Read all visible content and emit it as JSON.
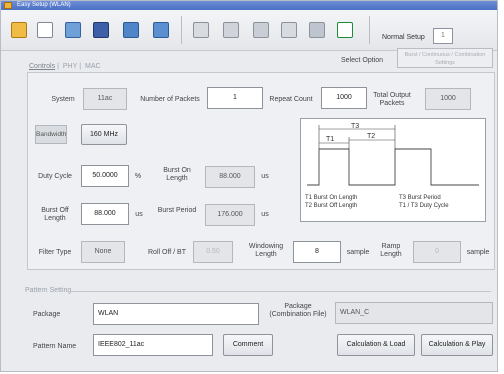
{
  "window": {
    "title": "Easy Setup (WLAN)"
  },
  "toolbar": {
    "normal_setup_label": "Normal Setup",
    "normal_setup_value": "1"
  },
  "select_option": {
    "label": "Select Option",
    "button_text": "Burst / Continuous / Combination Settings"
  },
  "tabs": [
    "Controls",
    "PHY",
    "MAC"
  ],
  "controls": {
    "system_label": "System",
    "system_value": "11ac",
    "num_packets_label": "Number of Packets",
    "num_packets_value": "1",
    "repeat_count_label": "Repeat Count",
    "repeat_count_value": "1000",
    "total_output_label": "Total Output Packets",
    "total_output_value": "1000",
    "bandwidth_label": "Bandwidth",
    "bandwidth_value": "160 MHz",
    "duty_cycle_label": "Duty Cycle",
    "duty_cycle_value": "50.0000",
    "duty_cycle_unit": "%",
    "burst_on_label": "Burst On Length",
    "burst_on_value": "88.000",
    "burst_on_unit": "us",
    "burst_off_label": "Burst Off Length",
    "burst_off_value": "88.000",
    "burst_off_unit": "us",
    "burst_period_label": "Burst Period",
    "burst_period_value": "176.000",
    "burst_period_unit": "us",
    "filter_type_label": "Filter Type",
    "filter_type_value": "None",
    "rolloff_label": "Roll Off / BT",
    "rolloff_value": "0.50",
    "windowing_label": "Windowing Length",
    "windowing_value": "8",
    "windowing_unit": "sample",
    "ramp_label": "Ramp Length",
    "ramp_value": "0",
    "ramp_unit": "sample"
  },
  "diagram": {
    "t1": "T1",
    "t2": "T2",
    "t3": "T3",
    "legend": [
      "T1  Burst On Length",
      "T2  Burst Off Length",
      "T3  Burst Period",
      "T1 / T3  Duty Cycle"
    ]
  },
  "pattern_setting": {
    "legend": "Pattern Setting",
    "package_label": "Package",
    "package_value": "WLAN",
    "package_combo_label": "Package (Combination File)",
    "package_combo_value": "WLAN_C",
    "pattern_name_label": "Pattern Name",
    "pattern_name_value": "IEEE802_11ac",
    "comment_button": "Comment",
    "calc_load_button": "Calculation & Load",
    "calc_play_button": "Calculation & Play"
  }
}
